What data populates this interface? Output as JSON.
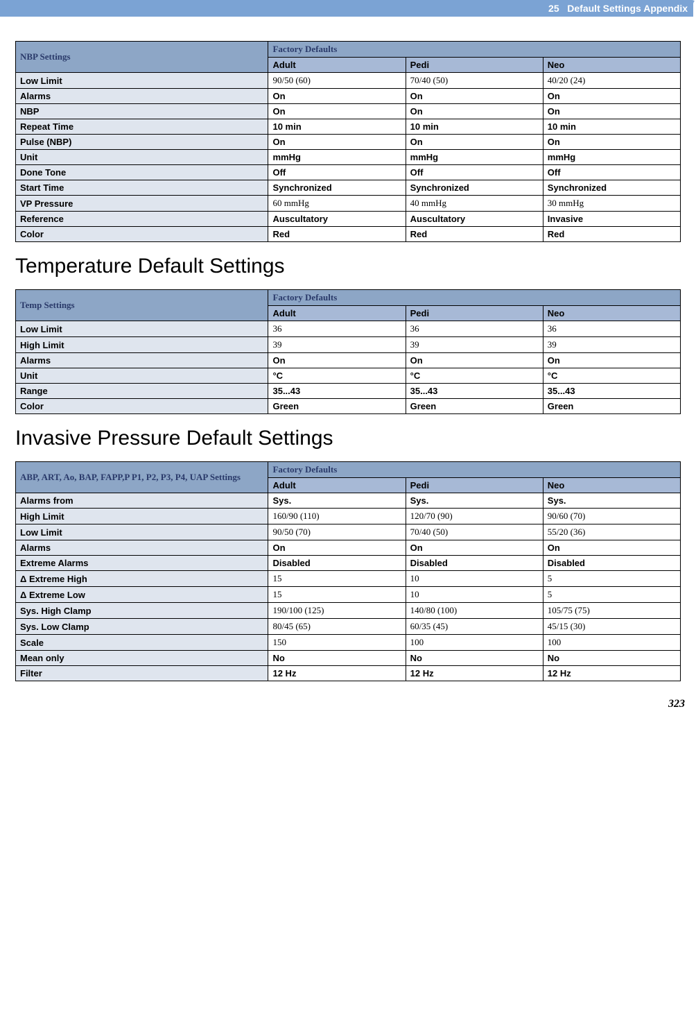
{
  "header": {
    "chapter_number": "25",
    "chapter_title": "Default Settings Appendix"
  },
  "nbp": {
    "title": "NBP Settings",
    "group": "Factory Defaults",
    "cols": [
      "Adult",
      "Pedi",
      "Neo"
    ],
    "rows": [
      {
        "label": "Low Limit",
        "vals": [
          "90/50 (60)",
          "70/40 (50)",
          "40/20 (24)"
        ],
        "style": "serif"
      },
      {
        "label": "Alarms",
        "vals": [
          "On",
          "On",
          "On"
        ],
        "style": "bold"
      },
      {
        "label": "NBP",
        "vals": [
          "On",
          "On",
          "On"
        ],
        "style": "bold"
      },
      {
        "label": "Repeat Time",
        "vals": [
          "10 min",
          "10 min",
          "10 min"
        ],
        "style": "bold"
      },
      {
        "label": "Pulse (NBP)",
        "vals": [
          "On",
          "On",
          "On"
        ],
        "style": "bold"
      },
      {
        "label": "Unit",
        "vals": [
          "mmHg",
          "mmHg",
          "mmHg"
        ],
        "style": "bold"
      },
      {
        "label": "Done Tone",
        "vals": [
          "Off",
          "Off",
          "Off"
        ],
        "style": "bold"
      },
      {
        "label": "Start Time",
        "vals": [
          "Synchronized",
          "Synchronized",
          "Synchronized"
        ],
        "style": "bold"
      },
      {
        "label": "VP Pressure",
        "vals": [
          "60 mmHg",
          "40 mmHg",
          "30 mmHg"
        ],
        "style": "serif"
      },
      {
        "label": "Reference",
        "vals": [
          "Auscultatory",
          "Auscultatory",
          "Invasive"
        ],
        "style": "bold"
      },
      {
        "label": "Color",
        "vals": [
          "Red",
          "Red",
          "Red"
        ],
        "style": "bold"
      }
    ]
  },
  "temp_heading": "Temperature Default Settings",
  "temp": {
    "title": "Temp Settings",
    "group": "Factory Defaults",
    "cols": [
      "Adult",
      "Pedi",
      "Neo"
    ],
    "rows": [
      {
        "label": "Low Limit",
        "vals": [
          "36",
          "36",
          "36"
        ],
        "style": "serif"
      },
      {
        "label": "High Limit",
        "vals": [
          "39",
          "39",
          "39"
        ],
        "style": "serif"
      },
      {
        "label": "Alarms",
        "vals": [
          "On",
          "On",
          "On"
        ],
        "style": "bold"
      },
      {
        "label": "Unit",
        "vals": [
          "°C",
          "°C",
          "°C"
        ],
        "style": "bold"
      },
      {
        "label": "Range",
        "vals": [
          "35...43",
          "35...43",
          "35...43"
        ],
        "style": "bold"
      },
      {
        "label": "Color",
        "vals": [
          "Green",
          "Green",
          "Green"
        ],
        "style": "bold"
      }
    ]
  },
  "inv_heading": "Invasive Pressure Default Settings",
  "inv": {
    "title": "ABP, ART, Ao, BAP, FAPP,P P1, P2, P3, P4, UAP Settings",
    "group": "Factory Defaults",
    "cols": [
      "Adult",
      "Pedi",
      "Neo"
    ],
    "rows": [
      {
        "label": "Alarms from",
        "vals": [
          "Sys.",
          "Sys.",
          "Sys."
        ],
        "style": "bold"
      },
      {
        "label": "High Limit",
        "vals": [
          "160/90 (110)",
          "120/70 (90)",
          "90/60 (70)"
        ],
        "style": "serif"
      },
      {
        "label": "Low Limit",
        "vals": [
          "90/50 (70)",
          "70/40 (50)",
          "55/20 (36)"
        ],
        "style": "serif"
      },
      {
        "label": "Alarms",
        "vals": [
          "On",
          "On",
          "On"
        ],
        "style": "bold"
      },
      {
        "label": "Extreme Alarms",
        "vals": [
          "Disabled",
          "Disabled",
          "Disabled"
        ],
        "style": "bold"
      },
      {
        "label": "Δ Extreme High",
        "vals": [
          "15",
          "10",
          "5"
        ],
        "style": "serif"
      },
      {
        "label": "Δ Extreme Low",
        "vals": [
          "15",
          "10",
          "5"
        ],
        "style": "serif"
      },
      {
        "label": "Sys. High Clamp",
        "vals": [
          "190/100 (125)",
          "140/80 (100)",
          "105/75 (75)"
        ],
        "style": "serif"
      },
      {
        "label": "Sys. Low Clamp",
        "vals": [
          "80/45 (65)",
          "60/35 (45)",
          "45/15 (30)"
        ],
        "style": "serif"
      },
      {
        "label": "Scale",
        "vals": [
          "150",
          "100",
          "100"
        ],
        "style": "serif"
      },
      {
        "label": "Mean only",
        "vals": [
          "No",
          "No",
          "No"
        ],
        "style": "bold"
      },
      {
        "label": "Filter",
        "vals": [
          "12 Hz",
          "12 Hz",
          "12 Hz"
        ],
        "style": "bold"
      }
    ]
  },
  "page_number": "323"
}
